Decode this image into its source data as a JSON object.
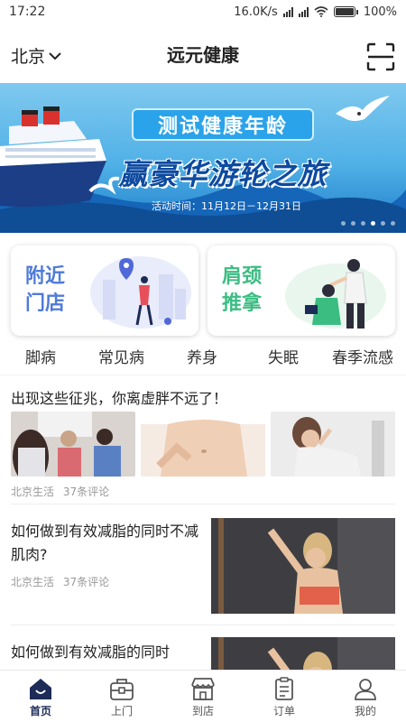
{
  "status_bar": {
    "time": "17:22",
    "network_speed": "16.0K/s",
    "battery": "100%"
  },
  "header": {
    "city": "北京",
    "title": "远元健康",
    "scan_icon": "scan-icon"
  },
  "banner": {
    "tag": "测试健康年龄",
    "headline": "赢豪华游轮之旅",
    "time": "活动时间：11月12日－12月31日",
    "page_count": 6,
    "active_page": 4
  },
  "cards": [
    {
      "label": "附近\n门店",
      "color": "#4f7bd9"
    },
    {
      "label": "肩颈\n推拿",
      "color": "#3bbd82"
    }
  ],
  "tabs": [
    "脚病",
    "常见病",
    "养身",
    "失眠",
    "春季流感"
  ],
  "articles": [
    {
      "title": "出现这些征兆，你离虚胖不远了！",
      "source": "北京生活",
      "comments": "37条评论"
    },
    {
      "title": "如何做到有效减脂的同时不减肌肉?",
      "source": "北京生活",
      "comments": "37条评论"
    },
    {
      "title": "如何做到有效减脂的同时"
    }
  ],
  "nav": [
    {
      "label": "首页",
      "icon": "home-icon",
      "active": true
    },
    {
      "label": "上门",
      "icon": "toolbox-icon",
      "active": false
    },
    {
      "label": "到店",
      "icon": "store-icon",
      "active": false
    },
    {
      "label": "订单",
      "icon": "clipboard-icon",
      "active": false
    },
    {
      "label": "我的",
      "icon": "user-icon",
      "active": false
    }
  ],
  "colors": {
    "primary": "#1d2b57",
    "card_blue": "#4f7bd9",
    "card_green": "#3bbd82",
    "banner_sky": "#4fb0e6"
  }
}
